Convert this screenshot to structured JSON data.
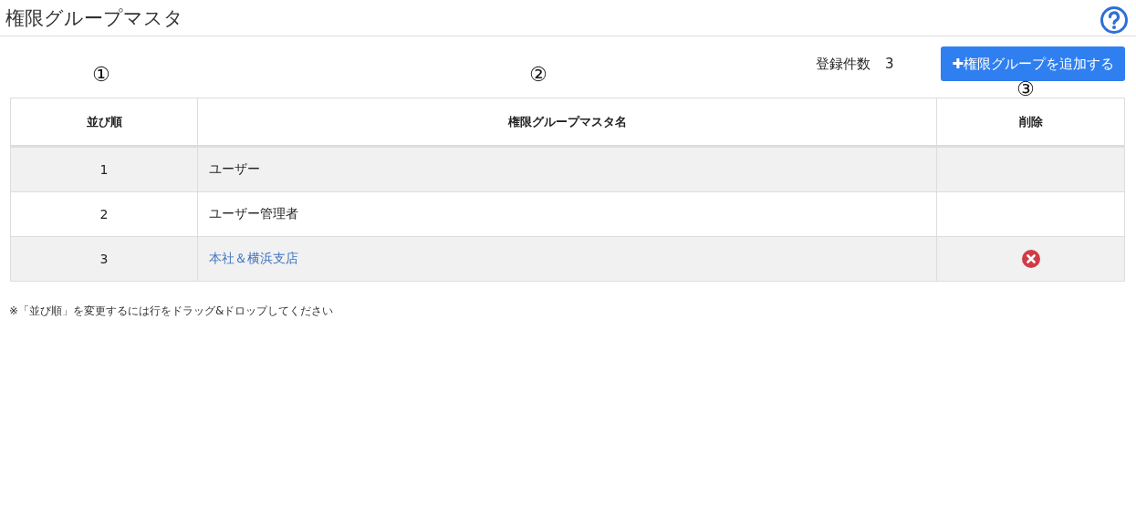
{
  "title": "権限グループマスタ",
  "count": {
    "label": "登録件数",
    "value": "3"
  },
  "add_button": {
    "icon": "✚",
    "label": "権限グループを追加する"
  },
  "annotations": [
    "①",
    "②",
    "③"
  ],
  "table": {
    "columns": [
      "並び順",
      "権限グループマスタ名",
      "削除"
    ],
    "rows": [
      {
        "order": "1",
        "name": "ユーザー",
        "link": false,
        "deletable": false
      },
      {
        "order": "2",
        "name": "ユーザー管理者",
        "link": false,
        "deletable": false
      },
      {
        "order": "3",
        "name": "本社＆横浜支店",
        "link": true,
        "deletable": true
      }
    ]
  },
  "note": "※「並び順」を変更するには行をドラッグ&ドロップしてください"
}
